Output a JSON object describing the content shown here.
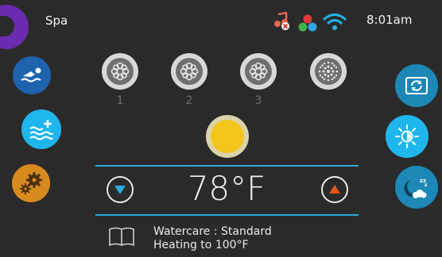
{
  "status_bar": {
    "title": "Spa",
    "time": "8:01am",
    "icons": [
      "music-muted-icon",
      "color-dots-icon",
      "wifi-icon"
    ]
  },
  "pumps": [
    {
      "label": "1"
    },
    {
      "label": "2"
    },
    {
      "label": "3"
    },
    {
      "label": ""
    }
  ],
  "temperature": {
    "value": "78°F"
  },
  "status": {
    "watercare": "Watercare : Standard",
    "heating": "Heating to 100°F"
  },
  "colors": {
    "background": "#2a2a2a",
    "accent_blue": "#2ea8d6",
    "bright_blue": "#1fb6ee",
    "orange": "#d98a1f",
    "purple": "#6a2bb0",
    "light_yellow": "#f4c51b",
    "up_arrow": "#e8551a"
  }
}
